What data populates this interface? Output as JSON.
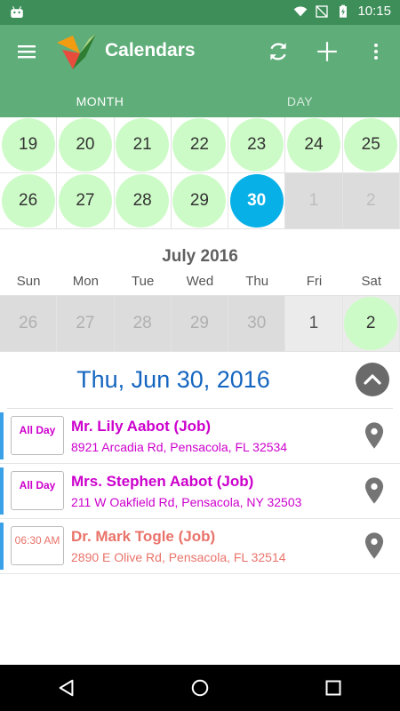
{
  "status_bar": {
    "time": "10:15"
  },
  "toolbar": {
    "title": "Calendars",
    "menu_icon": "hamburger-icon",
    "refresh_icon": "refresh-icon",
    "add_icon": "plus-icon",
    "overflow_icon": "more-vert-icon"
  },
  "tabs": [
    {
      "label": "MONTH",
      "active": true
    },
    {
      "label": "DAY",
      "active": false
    }
  ],
  "june_grid": {
    "rows": [
      [
        "19",
        "20",
        "21",
        "22",
        "23",
        "24",
        "25"
      ],
      [
        "26",
        "27",
        "28",
        "29",
        "30",
        "1",
        "2"
      ]
    ],
    "selected_day": "30"
  },
  "july": {
    "title": "July 2016",
    "weekdays": [
      "Sun",
      "Mon",
      "Tue",
      "Wed",
      "Thu",
      "Fri",
      "Sat"
    ],
    "row": [
      "26",
      "27",
      "28",
      "29",
      "30",
      "1",
      "2"
    ]
  },
  "day_header": {
    "date": "Thu, Jun 30, 2016"
  },
  "events": [
    {
      "time": "All Day",
      "name": "Mr. Lily Aabot (Job)",
      "address": "8921 Arcadia Rd, Pensacola, FL 32534"
    },
    {
      "time": "All Day",
      "name": "Mrs. Stephen Aabot (Job)",
      "address": "211 W Oakfield Rd, Pensacola, NY 32503"
    },
    {
      "time": "06:30 AM",
      "name": "Dr. Mark Togle (Job)",
      "address": "2890 E Olive Rd, Pensacola, FL 32514"
    }
  ],
  "colors": {
    "toolbar": "#5fad79",
    "status_bar": "#3e8e5a",
    "tab_indicator": "#f39c12",
    "day_circle": "#cdfbc7",
    "selected_circle": "#08b0e8",
    "date_text": "#1565c0",
    "event_purple": "#cc00cc",
    "event_salmon": "#e9736a"
  }
}
